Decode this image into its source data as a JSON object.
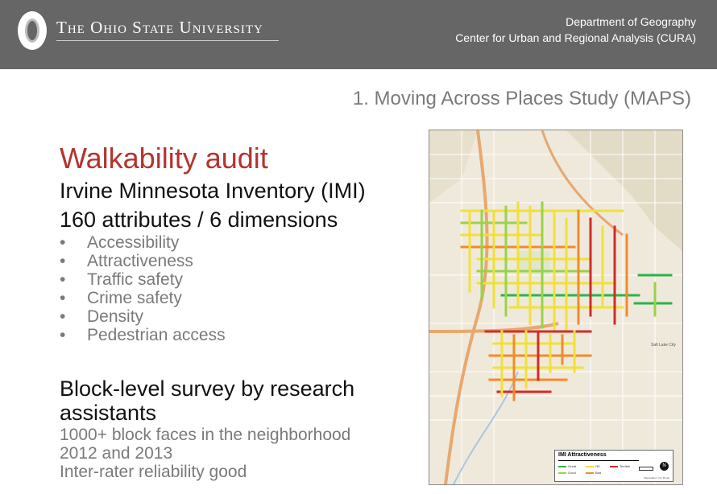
{
  "header": {
    "university": "The Ohio State University",
    "dept_line1": "Department of Geography",
    "dept_line2": "Center for Urban and Regional Analysis (CURA)"
  },
  "slide_title": "1. Moving Across Places Study (MAPS)",
  "content": {
    "heading": "Walkability audit",
    "subheading1": "Irvine Minnesota Inventory (IMI)",
    "subheading2": "160 attributes / 6 dimensions",
    "dimensions": [
      "Accessibility",
      "Attractiveness",
      "Traffic safety",
      "Crime safety",
      "Density",
      "Pedestrian access"
    ],
    "block_heading": "Block-level survey by research assistants",
    "notes": [
      "1000+ block faces in the neighborhood",
      "2012 and 2013",
      "Inter-rater reliability good"
    ]
  },
  "map": {
    "legend_title": "IMI Attractiveness",
    "legend_items": [
      {
        "label": "Great",
        "color": "#2db34a"
      },
      {
        "label": "OK",
        "color": "#f0e13a"
      },
      {
        "label": "Terrible",
        "color": "#d32b27"
      },
      {
        "label": "Good",
        "color": "#9ad247"
      },
      {
        "label": "Bad",
        "color": "#f08c2a"
      }
    ],
    "compass": "N",
    "place_label": "Salt Lake City",
    "credit": "Map Author: C.F. Thody"
  },
  "colors": {
    "header_bg": "#666666",
    "heading_red": "#b5332d",
    "gray_text": "#7a7a7a"
  }
}
